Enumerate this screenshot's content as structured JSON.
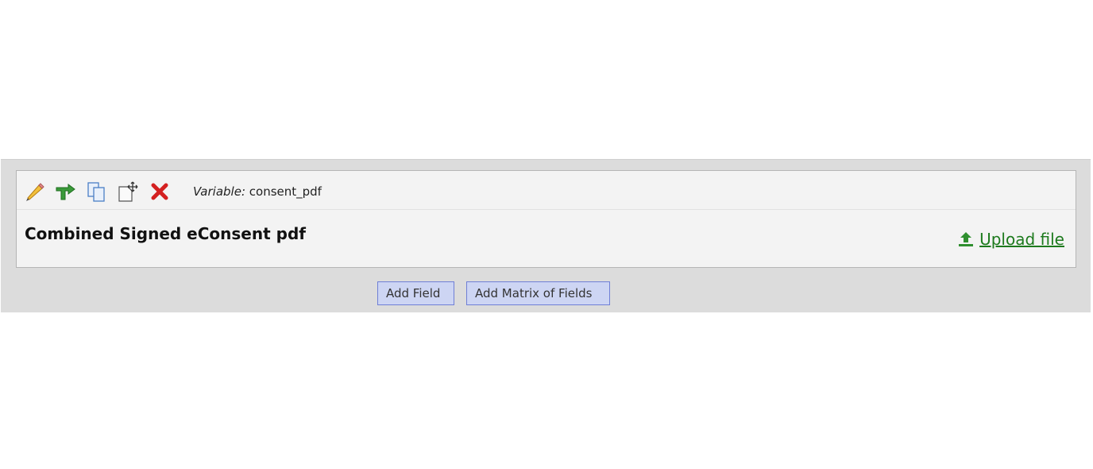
{
  "field": {
    "variable_label": "Variable:",
    "variable_name": "consent_pdf",
    "label": "Combined Signed eConsent pdf",
    "upload_label": "Upload file"
  },
  "toolbar": {
    "icons": [
      "pencil-icon",
      "branching-logic-icon",
      "copy-icon",
      "move-icon",
      "delete-icon"
    ]
  },
  "actions": {
    "add_field": "Add Field",
    "add_matrix": "Add Matrix of Fields"
  },
  "colors": {
    "panel_bg": "#dcdcdc",
    "field_bg": "#f3f3f3",
    "upload_link": "#1d7a1d",
    "button_bg": "#cdd5f3",
    "button_border": "#6f7fd6",
    "delete_red": "#d42020"
  }
}
